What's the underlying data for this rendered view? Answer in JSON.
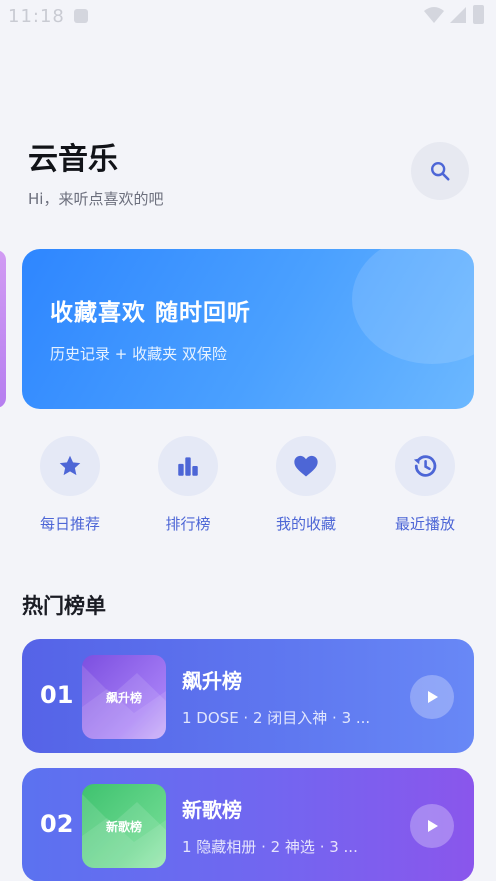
{
  "status_bar": {
    "time": "11:18",
    "icons": [
      "notification-icon",
      "wifi-icon",
      "signal-icon",
      "battery-icon"
    ]
  },
  "header": {
    "title": "云音乐",
    "subtitle": "Hi，来听点喜欢的吧",
    "search_icon": "search-icon"
  },
  "banner": {
    "title": "收藏喜欢 随时回听",
    "subtitle": "历史记录 + 收藏夹 双保险"
  },
  "quick_actions": [
    {
      "label": "每日推荐",
      "icon": "star-icon"
    },
    {
      "label": "排行榜",
      "icon": "bar-chart-icon"
    },
    {
      "label": "我的收藏",
      "icon": "heart-icon"
    },
    {
      "label": "最近播放",
      "icon": "history-icon"
    }
  ],
  "hot_charts": {
    "title": "热门榜单",
    "items": [
      {
        "rank": "01",
        "cover_text": "飙升榜",
        "name": "飙升榜",
        "tracks": "1 DOSE  ·  2 闭目入神  ·  3 ..."
      },
      {
        "rank": "02",
        "cover_text": "新歌榜",
        "name": "新歌榜",
        "tracks": "1 隐藏相册  ·  2 神选  ·  3 ..."
      }
    ]
  },
  "colors": {
    "accent": "#4d66d6",
    "banner_start": "#2e86ff",
    "banner_end": "#6cb8ff",
    "background": "#f3f4f9"
  }
}
